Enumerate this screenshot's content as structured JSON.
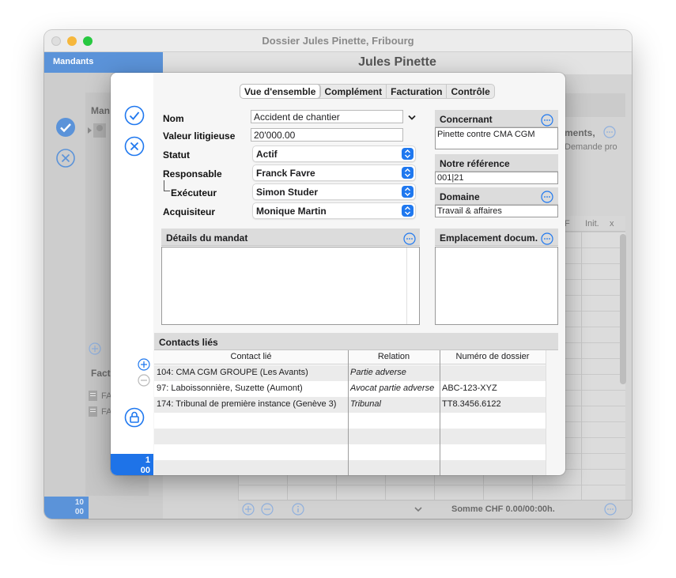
{
  "window": {
    "title": "Dossier Jules Pinette, Fribourg",
    "traffic_colors": [
      "#dedede",
      "#f6b73c",
      "#27c840"
    ]
  },
  "background": {
    "sidebar_header": "Mandants",
    "main_title": "Jules Pinette",
    "mandate_label": "Man",
    "fact_label": "Fact",
    "fa1": "FA",
    "fa2": "FA",
    "partial_header": "ments,",
    "partial_value": "Demande pro",
    "col_f": "F",
    "col_init": "Init.",
    "col_x": "x",
    "sum_text": "Somme CHF 0.00/00:00h.",
    "badge_top": "10",
    "badge_bottom": "00"
  },
  "sheet": {
    "tabs": [
      {
        "label": "Vue d'ensemble",
        "active": true
      },
      {
        "label": "Complément",
        "active": false
      },
      {
        "label": "Facturation",
        "active": false
      },
      {
        "label": "Contrôle",
        "active": false
      }
    ],
    "form": {
      "nom_label": "Nom",
      "nom_value": "Accident de chantier",
      "valeur_label": "Valeur litigieuse",
      "valeur_value": "20'000.00",
      "statut_label": "Statut",
      "statut_value": "Actif",
      "responsable_label": "Responsable",
      "responsable_value": "Franck Favre",
      "executeur_label": "Exécuteur",
      "executeur_value": "Simon Studer",
      "acquisiteur_label": "Acquisiteur",
      "acquisiteur_value": "Monique Martin"
    },
    "concernant": {
      "label": "Concernant",
      "value": "Pinette contre CMA CGM"
    },
    "reference": {
      "label": "Notre référence",
      "value": "001|21"
    },
    "domaine": {
      "label": "Domaine",
      "value": "Travail & affaires"
    },
    "details": {
      "label": "Détails du mandat",
      "value": ""
    },
    "emplacement": {
      "label": "Emplacement docum.",
      "value": ""
    },
    "contacts": {
      "label": "Contacts liés",
      "columns": [
        "Contact lié",
        "Relation",
        "Numéro de dossier"
      ],
      "rows": [
        {
          "contact": "104: CMA CGM GROUPE (Les Avants)",
          "relation": "Partie adverse",
          "dossier": ""
        },
        {
          "contact": "97: Laboissonnière, Suzette (Aumont)",
          "relation": "Avocat partie adverse",
          "dossier": "ABC-123-XYZ"
        },
        {
          "contact": "174: Tribunal de première instance (Genève 3)",
          "relation": "Tribunal",
          "dossier": "TT8.3456.6122"
        }
      ]
    },
    "badge_top": "1",
    "badge_bottom": "00",
    "accent_color": "#1f78ef"
  }
}
